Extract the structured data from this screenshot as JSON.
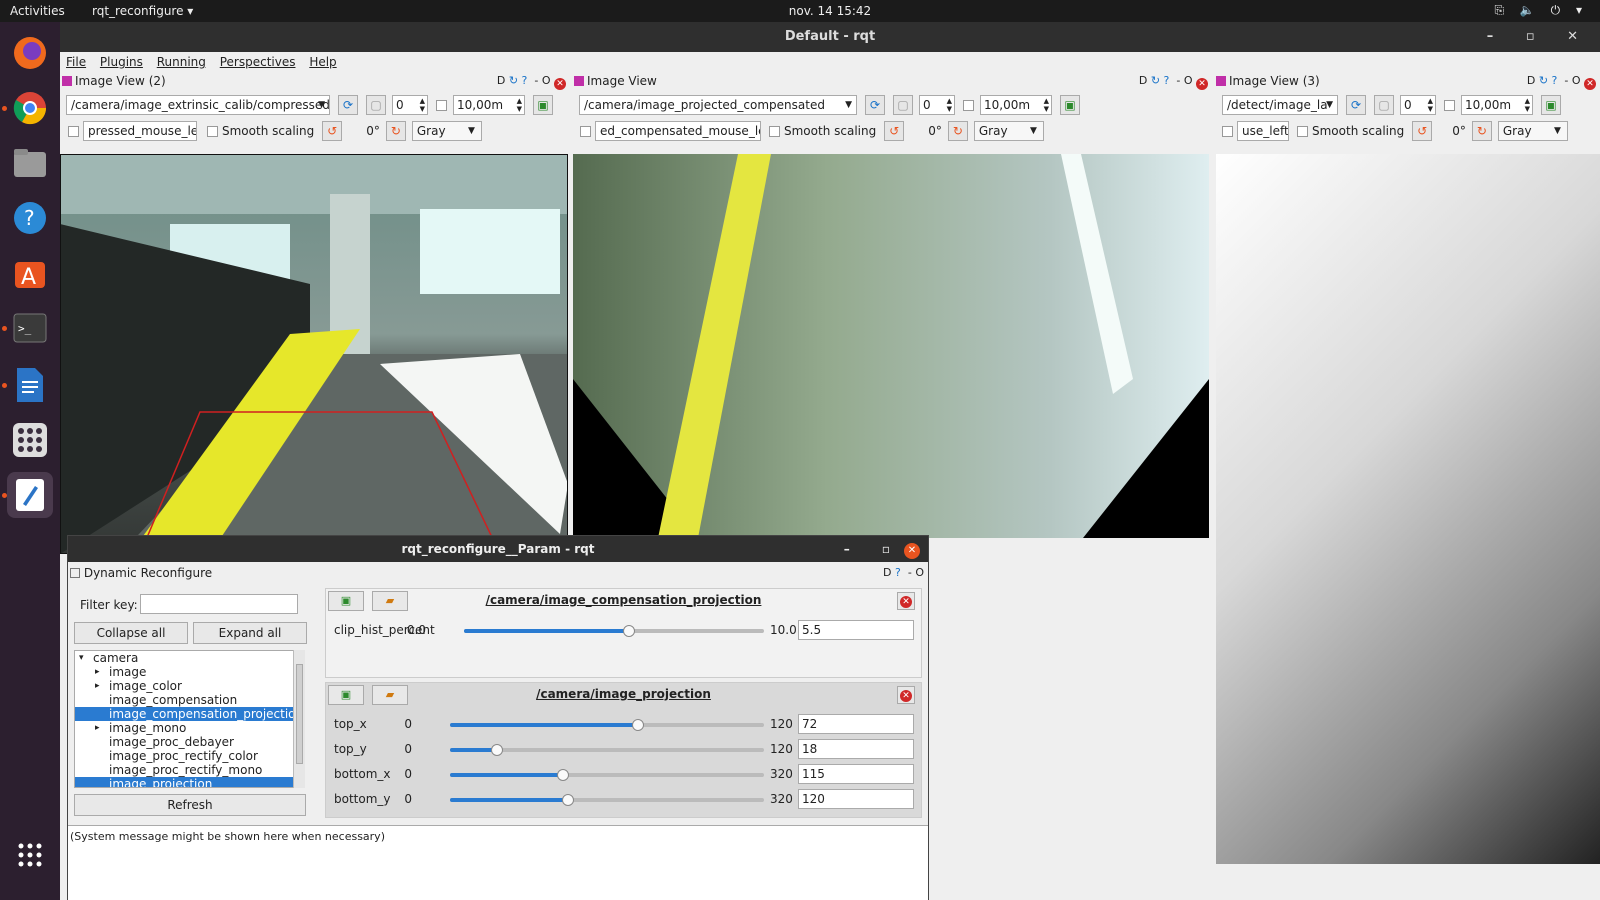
{
  "topbar": {
    "activities": "Activities",
    "app_name": "rqt_reconfigure",
    "clock": "nov. 14  15:42",
    "tray": "⎘ 🔈 ⏻ ▾"
  },
  "window": {
    "title": "Default - rqt",
    "controls": "– ▫ ✕"
  },
  "menu": [
    "File",
    "Plugins",
    "Running",
    "Perspectives",
    "Help"
  ],
  "panes": [
    {
      "title": "Image View (2)",
      "topic": "/camera/image_extrinsic_calib/compressed",
      "spin": "0",
      "rate": "10,00m",
      "mouse": "pressed_mouse_left",
      "smooth": "Smooth scaling",
      "rot": "0°",
      "color": "Gray",
      "rt": "D",
      "rt_extra": "- O"
    },
    {
      "title": "Image View",
      "topic": "/camera/image_projected_compensated",
      "spin": "0",
      "rate": "10,00m",
      "mouse": "ed_compensated_mouse_left",
      "smooth": "Smooth scaling",
      "rot": "0°",
      "color": "Gray",
      "rt": "D",
      "rt_extra": "- O"
    },
    {
      "title": "Image View (3)",
      "topic": "/detect/image_la",
      "spin": "0",
      "rate": "10,00m",
      "mouse": "use_left",
      "smooth": "Smooth scaling",
      "rot": "0°",
      "color": "Gray",
      "rt": "D",
      "rt_extra": "- O"
    }
  ],
  "dialog": {
    "title": "rqt_reconfigure__Param - rqt",
    "controls": "–  ▫",
    "close": "✕",
    "plugin": "Dynamic Reconfigure",
    "plugin_rt": "D",
    "plugin_rt_extra": "- O",
    "filter_label": "Filter key:",
    "filter_value": "",
    "collapse": "Collapse all",
    "expand": "Expand all",
    "refresh": "Refresh",
    "tree": [
      {
        "label": "camera",
        "depth": 0,
        "arrow": "▾",
        "sel": false
      },
      {
        "label": "image",
        "depth": 1,
        "arrow": "▸",
        "sel": false
      },
      {
        "label": "image_color",
        "depth": 1,
        "arrow": "▸",
        "sel": false
      },
      {
        "label": "image_compensation",
        "depth": 1,
        "arrow": "",
        "sel": false
      },
      {
        "label": "image_compensation_projection",
        "depth": 1,
        "arrow": "",
        "sel": true
      },
      {
        "label": "image_mono",
        "depth": 1,
        "arrow": "▸",
        "sel": false
      },
      {
        "label": "image_proc_debayer",
        "depth": 1,
        "arrow": "",
        "sel": false
      },
      {
        "label": "image_proc_rectify_color",
        "depth": 1,
        "arrow": "",
        "sel": false
      },
      {
        "label": "image_proc_rectify_mono",
        "depth": 1,
        "arrow": "",
        "sel": false
      },
      {
        "label": "image_projection",
        "depth": 1,
        "arrow": "",
        "sel": true
      }
    ],
    "groups": [
      {
        "name": "/camera/image_compensation_projection",
        "params": [
          {
            "name": "clip_hist_percent",
            "min": "0.0",
            "max": "10.0",
            "value": "5.5",
            "fraction": 0.55
          }
        ]
      },
      {
        "name": "/camera/image_projection",
        "params": [
          {
            "name": "top_x",
            "min": "0",
            "max": "120",
            "value": "72",
            "fraction": 0.6
          },
          {
            "name": "top_y",
            "min": "0",
            "max": "120",
            "value": "18",
            "fraction": 0.15
          },
          {
            "name": "bottom_x",
            "min": "0",
            "max": "320",
            "value": "115",
            "fraction": 0.36
          },
          {
            "name": "bottom_y",
            "min": "0",
            "max": "320",
            "value": "120",
            "fraction": 0.375
          }
        ]
      }
    ],
    "system_message": "(System message might be shown here when necessary)"
  },
  "icons": {
    "save": "save-icon",
    "open": "folder-open-icon",
    "refresh": "refresh-icon",
    "rotate": "rotate-icon"
  },
  "colors": {
    "accent": "#2a7bd1",
    "close": "#d02828",
    "ubuntu_orange": "#e95420"
  }
}
